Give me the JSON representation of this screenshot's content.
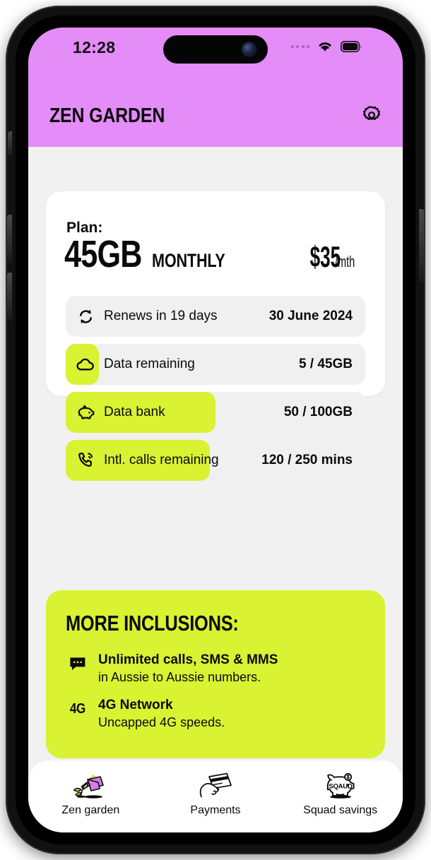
{
  "status_bar": {
    "time": "12:28",
    "signal_icon": "signal-dots-icon",
    "wifi_icon": "wifi-icon",
    "battery_icon": "battery-full-icon"
  },
  "header": {
    "title": "ZEN GARDEN",
    "settings_icon": "gear-icon",
    "background_color": "#e48cf7"
  },
  "plan_card": {
    "label": "Plan:",
    "size": "45GB",
    "period": "MONTHLY",
    "price_amount": "$35",
    "price_unit": "/mth",
    "rows": [
      {
        "icon": "refresh-icon",
        "label": "Renews in 19 days",
        "value": "30 June 2024",
        "fill_percent": 0
      },
      {
        "icon": "cloud-icon",
        "label": "Data remaining",
        "value": "5 / 45GB",
        "fill_percent": 11
      },
      {
        "icon": "piggy-bank-icon",
        "label": "Data bank",
        "value": "50 / 100GB",
        "fill_percent": 50
      },
      {
        "icon": "phone-call-icon",
        "label": "Intl. calls remaining",
        "value": "120 / 250 mins",
        "fill_percent": 48
      }
    ]
  },
  "inclusions": {
    "title": "MORE INCLUSIONS:",
    "background_color": "#d9f231",
    "items": [
      {
        "icon": "chat-bubble-icon",
        "title": "Unlimited calls, SMS & MMS",
        "subtitle": "in Aussie to Aussie numbers."
      },
      {
        "icon": "4g-icon",
        "icon_text": "4G",
        "title": "4G Network",
        "subtitle": "Uncapped 4G speeds."
      }
    ]
  },
  "bottom_nav": {
    "items": [
      {
        "icon": "watering-can-icon",
        "label": "Zen garden",
        "active": true
      },
      {
        "icon": "hand-card-icon",
        "label": "Payments",
        "active": false
      },
      {
        "icon": "piggy-bank-squad-icon",
        "label": "Squad savings",
        "active": false
      }
    ]
  },
  "theme": {
    "accent_magenta": "#e48cf7",
    "accent_lime": "#d9f231",
    "surface": "#ffffff",
    "background": "#f1f1f1",
    "text": "#0a0a0a"
  }
}
